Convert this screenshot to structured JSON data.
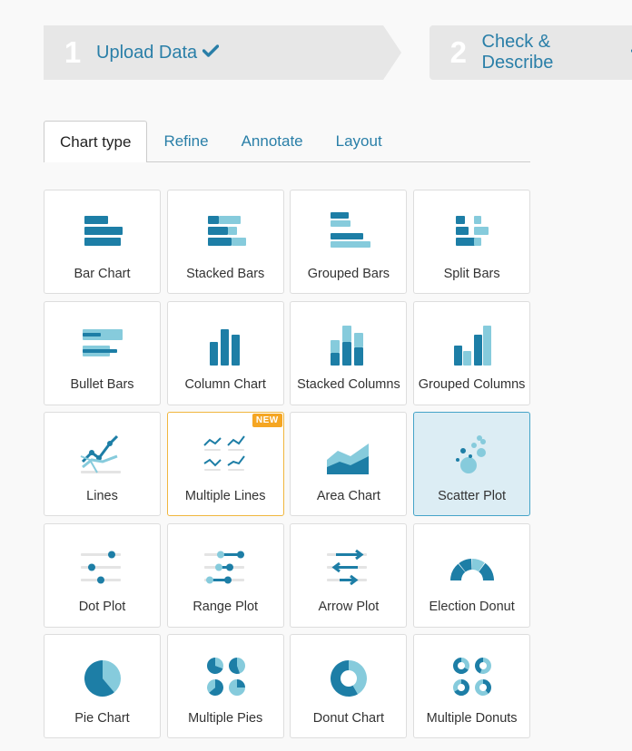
{
  "steps": [
    {
      "number": "1",
      "label": "Upload Data",
      "status": "done"
    },
    {
      "number": "2",
      "label": "Check & Describe",
      "status": "done"
    }
  ],
  "tabs": [
    "Chart type",
    "Refine",
    "Annotate",
    "Layout"
  ],
  "active_tab": "Chart type",
  "colors": {
    "dark": "#1d7ea6",
    "light": "#86cbdc",
    "accent_badge": "#f5a623",
    "selected_bg": "#dcedf4"
  },
  "chart_types": [
    {
      "label": "Bar Chart",
      "icon": "bar-chart-icon"
    },
    {
      "label": "Stacked Bars",
      "icon": "stacked-bars-icon"
    },
    {
      "label": "Grouped Bars",
      "icon": "grouped-bars-icon"
    },
    {
      "label": "Split Bars",
      "icon": "split-bars-icon"
    },
    {
      "label": "Bullet Bars",
      "icon": "bullet-bars-icon"
    },
    {
      "label": "Column Chart",
      "icon": "column-chart-icon"
    },
    {
      "label": "Stacked Columns",
      "icon": "stacked-columns-icon"
    },
    {
      "label": "Grouped Columns",
      "icon": "grouped-columns-icon"
    },
    {
      "label": "Lines",
      "icon": "lines-icon"
    },
    {
      "label": "Multiple Lines",
      "icon": "multiple-lines-icon",
      "badge": "NEW"
    },
    {
      "label": "Area Chart",
      "icon": "area-chart-icon"
    },
    {
      "label": "Scatter Plot",
      "icon": "scatter-plot-icon",
      "selected": true
    },
    {
      "label": "Dot Plot",
      "icon": "dot-plot-icon"
    },
    {
      "label": "Range Plot",
      "icon": "range-plot-icon"
    },
    {
      "label": "Arrow Plot",
      "icon": "arrow-plot-icon"
    },
    {
      "label": "Election Donut",
      "icon": "election-donut-icon"
    },
    {
      "label": "Pie Chart",
      "icon": "pie-chart-icon"
    },
    {
      "label": "Multiple Pies",
      "icon": "multiple-pies-icon"
    },
    {
      "label": "Donut Chart",
      "icon": "donut-chart-icon"
    },
    {
      "label": "Multiple Donuts",
      "icon": "multiple-donuts-icon"
    }
  ]
}
